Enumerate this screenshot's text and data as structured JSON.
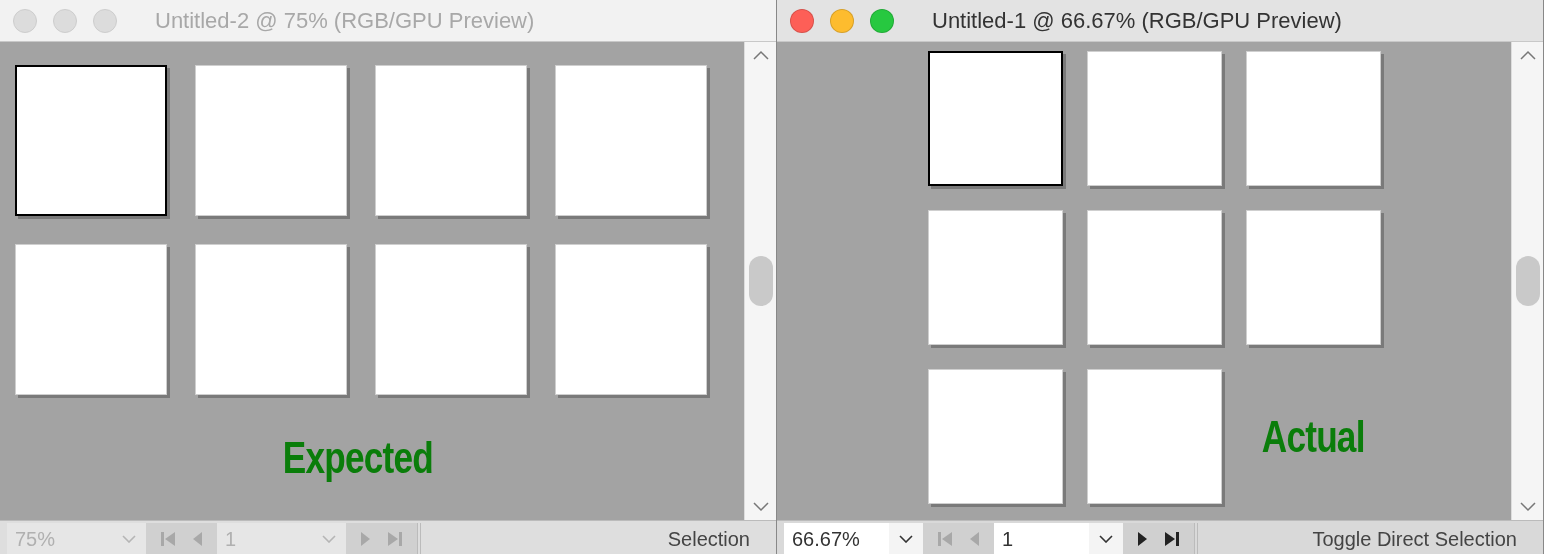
{
  "windows": [
    {
      "title": "Untitled-2 @ 75% (RGB/GPU Preview)",
      "kind": "wide",
      "active": false,
      "label": "Expected",
      "artboards": [
        {
          "selected": true
        },
        {
          "selected": false
        },
        {
          "selected": false
        },
        {
          "selected": false
        },
        {
          "selected": false
        },
        {
          "selected": false
        },
        {
          "selected": false
        },
        {
          "selected": false
        }
      ],
      "zoom": "75%",
      "page": "1",
      "status": "Selection"
    },
    {
      "title": "Untitled-1 @ 66.67% (RGB/GPU Preview)",
      "kind": "compact",
      "active": true,
      "label": "Actual",
      "artboards": [
        {
          "selected": true
        },
        {
          "selected": false
        },
        {
          "selected": false
        },
        {
          "selected": false
        },
        {
          "selected": false
        },
        {
          "selected": false
        },
        {
          "selected": false
        },
        {
          "selected": false
        }
      ],
      "zoom": "66.67%",
      "page": "1",
      "status": "Toggle Direct Selection"
    }
  ]
}
